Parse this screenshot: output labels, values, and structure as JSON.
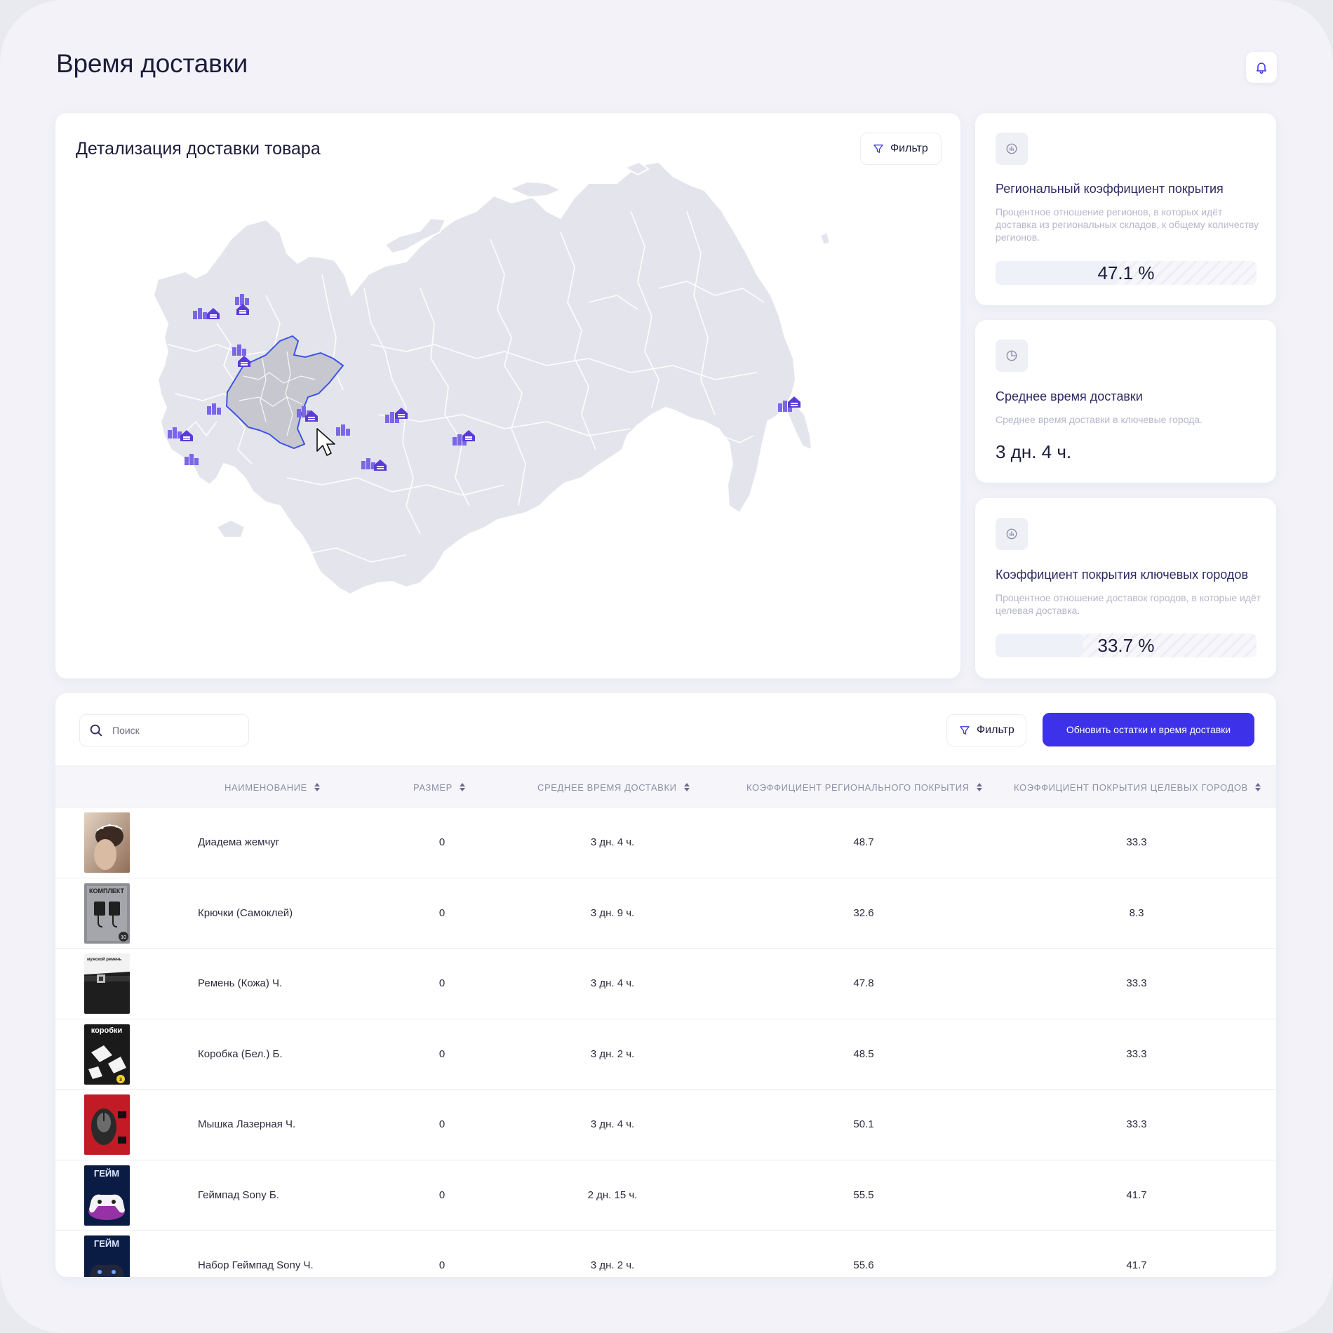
{
  "page": {
    "title": "Время доставки"
  },
  "icons": {
    "notifications": "bell-icon",
    "filter": "funnel-icon",
    "search": "search-icon",
    "cursor": "mouse-pointer-icon"
  },
  "map_card": {
    "title": "Детализация доставки товара",
    "filter_label": "Фильтр",
    "selected_region_color": "#3b55e6",
    "warehouse_icon_color": "#6c4cdc"
  },
  "stats": {
    "regional": {
      "icon": "chart-badge-icon",
      "title": "Региональный коэффициент покрытия",
      "description": "Процентное отношение регионов, в которых идёт доставка из региональных складов, к общему количеству регионов.",
      "value_label": "47.1 %",
      "value": 47.1
    },
    "avg_time": {
      "icon": "clock-pie-icon",
      "title": "Среднее время доставки",
      "description": "Среднее время доставки в ключевые города.",
      "value": "3 дн. 4 ч."
    },
    "key_cities": {
      "icon": "chart-badge-icon",
      "title": "Коэффициент покрытия ключевых городов",
      "description": "Процентное отношение доставок городов, в которые идёт целевая доставка.",
      "value_label": "33.7 %",
      "value": 33.7
    }
  },
  "table": {
    "search_placeholder": "Поиск",
    "filter_label": "Фильтр",
    "update_button": "Обновить остатки и время доставки",
    "columns": [
      "НАИМЕНОВАНИЕ",
      "РАЗМЕР",
      "СРЕДНЕЕ ВРЕМЯ ДОСТАВКИ",
      "КОЭФФИЦИЕНТ РЕГИОНАЛЬНОГО ПОКРЫТИЯ",
      "КОЭФФИЦИЕНТ ПОКРЫТИЯ ЦЕЛЕВЫХ ГОРОДОВ"
    ],
    "rows": [
      {
        "name": "Диадема жемчуг",
        "size": "0",
        "avg_time": "3 дн. 4 ч.",
        "regional": "48.7",
        "target": "33.3",
        "thumb": "tiara"
      },
      {
        "name": "Крючки (Самоклей)",
        "size": "0",
        "avg_time": "3 дн. 9 ч.",
        "regional": "32.6",
        "target": "8.3",
        "thumb": "hooks",
        "thumb_text": [
          "КОМПЛЕКТ",
          "10"
        ]
      },
      {
        "name": "Ремень (Кожа) Ч.",
        "size": "0",
        "avg_time": "3 дн. 4 ч.",
        "regional": "47.8",
        "target": "33.3",
        "thumb": "belt",
        "thumb_text": [
          "мужской ремень"
        ]
      },
      {
        "name": "Коробка (Бел.) Б.",
        "size": "0",
        "avg_time": "3 дн. 2 ч.",
        "regional": "48.5",
        "target": "33.3",
        "thumb": "boxes",
        "thumb_text": [
          "коробки",
          "3"
        ]
      },
      {
        "name": "Мышка Лазерная Ч.",
        "size": "0",
        "avg_time": "3 дн. 4 ч.",
        "regional": "50.1",
        "target": "33.3",
        "thumb": "mouse"
      },
      {
        "name": "Геймпад Sony Б.",
        "size": "0",
        "avg_time": "2 дн. 15 ч.",
        "regional": "55.5",
        "target": "41.7",
        "thumb": "gamepad-white",
        "thumb_text": [
          "ГЕЙМ"
        ]
      },
      {
        "name": "Набор Геймпад Sony Ч.",
        "size": "0",
        "avg_time": "3 дн. 2 ч.",
        "regional": "55.6",
        "target": "41.7",
        "thumb": "gamepad-black",
        "thumb_text": [
          "ГЕЙМ"
        ]
      }
    ]
  }
}
